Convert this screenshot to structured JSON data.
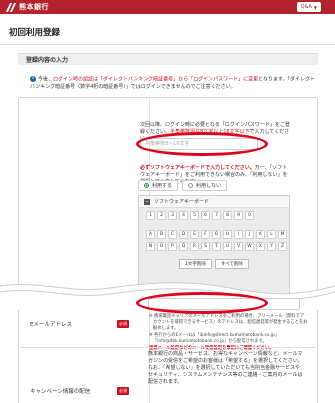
{
  "header": {
    "bank_name": "熊本銀行",
    "qa_button": "Q&A",
    "qa_caret": "▼",
    "brand_color": "#b4232d"
  },
  "page": {
    "title": "初回利用登録",
    "section_title": "登録内容の入力"
  },
  "notice": {
    "icon": "i",
    "part1": "今後、",
    "part2": "ログイン時の認証は「ダイレクトバンキング暗証番号」から「ログインパスワード」に変更",
    "part3": "となります。「ダイレクトバンキング暗証番号（数字4桁の暗証番号）」ではログインできませんのでご注意ください。"
  },
  "password": {
    "instruction": "次回以降、ログイン時に必要となる「ログインパスワード」をご登録ください。",
    "rule": "半角英数混在8文字以上16文字以下",
    "rule_suffix": "で入力してください。",
    "placeholder": "半角英数8～16文字",
    "warning_red": "必ずソフトウェアキーボードで入力してください。",
    "warning_rest": "万一、「ソフトウェアキーボード」をご利用できない場合のみ、「利用しない」を選択して入力してください。",
    "radio_use": "利用する",
    "radio_not_use": "利用しない",
    "keyboard_title": "ソフトウェアキーボード",
    "keyboard_minus": "−",
    "keys_numbers": [
      "1",
      "2",
      "3",
      "4",
      "5",
      "6",
      "7",
      "8",
      "9",
      "0"
    ],
    "keys_row2": [
      "A",
      "B",
      "C",
      "D",
      "E",
      "F",
      "G",
      "H",
      "I",
      "J",
      "K",
      "L",
      "M"
    ],
    "keys_row3": [
      "N",
      "O",
      "P",
      "Q",
      "R",
      "S",
      "T",
      "U",
      "V",
      "W",
      "X",
      "Y",
      "Z"
    ],
    "btn_delete_one": "1文字削除",
    "btn_delete_all": "すべて削除"
  },
  "email": {
    "label": "Eメールアドレス",
    "required": "必須",
    "notes": [
      "携帯電話キャリアのメールアドレスをご利用の場合、フリーメール（無料でアカウントを取得できるサービス）のアドレスは、配信遅延等が発生することをお勧めします。",
      "各行からのEメールは「ibinfo@direct.kumamotobank.co.jp」「info@dbk.kumamotobank.co.jp」から配信されます。",
      "迷惑メール設定などのメール受信設定を事前にご確認ください。"
    ]
  },
  "campaign": {
    "label": "キャンペーン情報の配信",
    "required": "必須",
    "text": "熊本銀行の商品・サービス、お得なキャンペーン情報など、メールマガジンの受信をご希望のお客様は「希望する」を選択してください。なお、「希望しない」を選択していただいても当則当金融サービスやセキュリティ、システムメンテナンス等のご連絡・ご案内のメールは配信されます。"
  }
}
